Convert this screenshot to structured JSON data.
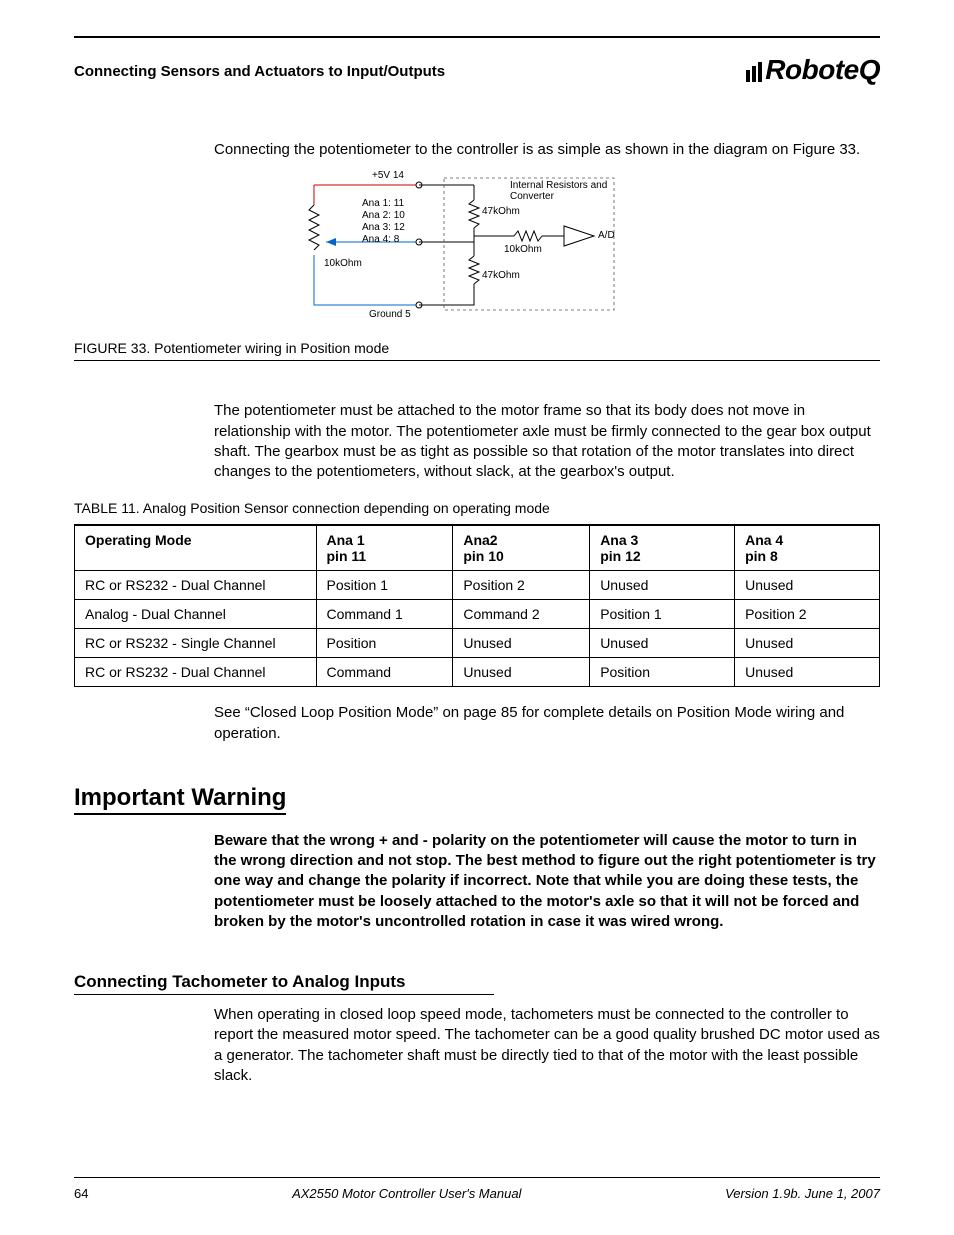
{
  "header": {
    "section": "Connecting Sensors and Actuators to Input/Outputs",
    "logo_text": "RoboteQ"
  },
  "intro_para": "Connecting the potentiometer to the controller is as simple as shown in the diagram on Figure 33.",
  "diagram": {
    "top": "+5V  14",
    "ana1": "Ana 1:  11",
    "ana2": "Ana 2:  10",
    "ana3": "Ana 3:  12",
    "ana4": "Ana 4:   8",
    "r_upper": "47kOhm",
    "r_mid": "10kOhm",
    "r_lower": "47kOhm",
    "pot": "10kOhm",
    "ground": "Ground  5",
    "ad": "A/D",
    "internal": "Internal Resistors and Converter"
  },
  "figure_caption": "FIGURE 33.  Potentiometer wiring in Position mode",
  "pot_para": "The potentiometer must be attached to the motor frame so that its body does not move in relationship with the motor. The potentiometer axle must be firmly connected to the gear box output shaft. The gearbox must be as tight as possible so that rotation of the motor translates into direct changes to the potentiometers, without slack, at the gearbox's output.",
  "table_caption": "TABLE 11. Analog Position Sensor connection depending on operating mode",
  "table": {
    "headers": {
      "c0": "Operating Mode",
      "c1a": "Ana 1",
      "c1b": "pin 11",
      "c2a": "Ana2",
      "c2b": "pin 10",
      "c3a": "Ana 3",
      "c3b": "pin 12",
      "c4a": "Ana 4",
      "c4b": "pin 8"
    },
    "rows": [
      {
        "mode": "RC or RS232 - Dual Channel",
        "a1": "Position 1",
        "a2": "Position 2",
        "a3": "Unused",
        "a4": "Unused"
      },
      {
        "mode": "Analog - Dual Channel",
        "a1": "Command 1",
        "a2": "Command 2",
        "a3": "Position 1",
        "a4": "Position 2"
      },
      {
        "mode": "RC or RS232 - Single Channel",
        "a1": "Position",
        "a2": "Unused",
        "a3": "Unused",
        "a4": "Unused"
      },
      {
        "mode": "RC or RS232 - Dual Channel",
        "a1": "Command",
        "a2": "Unused",
        "a3": "Position",
        "a4": "Unused"
      }
    ]
  },
  "see_para": "See “Closed Loop Position Mode” on page 85 for complete details on Position Mode wiring and operation.",
  "warning": {
    "head": "Important Warning",
    "text": "Beware that the wrong + and - polarity on the potentiometer will cause the motor to turn in the wrong direction and not stop. The best method to figure out the right potentiometer is try one way and change the polarity if incorrect. Note that while you are doing these tests, the potentiometer must be loosely attached to the motor's axle so that it will not be forced and broken by the motor's uncontrolled rotation in case it was wired wrong."
  },
  "tach": {
    "head": "Connecting Tachometer to Analog Inputs",
    "para": "When operating in closed loop speed mode, tachometers must be connected to the controller to report the measured motor speed. The tachometer can be a good quality brushed DC motor used as a generator. The tachometer shaft must be directly tied to that of the motor with the least possible slack."
  },
  "footer": {
    "page": "64",
    "title": "AX2550 Motor Controller User's Manual",
    "version": "Version 1.9b. June 1, 2007"
  }
}
